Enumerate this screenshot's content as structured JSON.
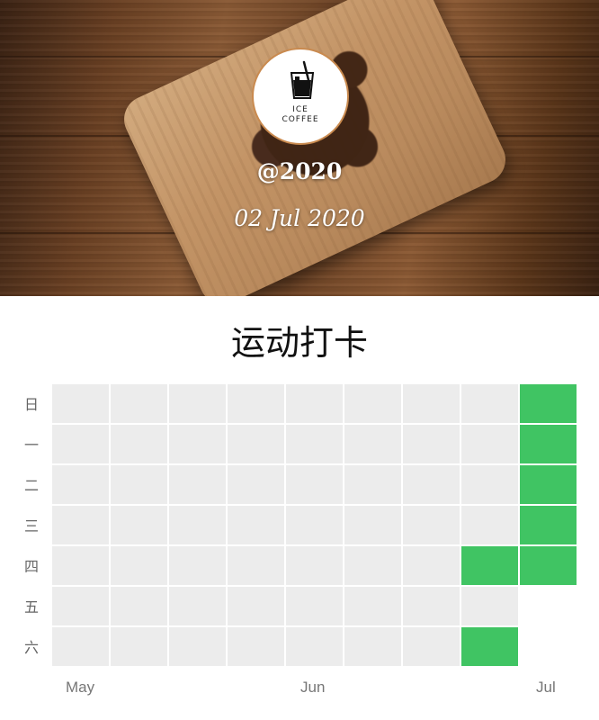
{
  "header": {
    "handle": "@2020",
    "date": "02 Jul 2020",
    "logo_text_line1": "ICE",
    "logo_text_line2": "COFFEE"
  },
  "section_title": "运动打卡",
  "heatmap": {
    "day_labels": [
      "日",
      "一",
      "二",
      "三",
      "四",
      "五",
      "六"
    ],
    "month_labels": [
      "May",
      "Jun",
      "Jul"
    ],
    "week_columns": 9,
    "checked_color": "#40c463",
    "unchecked_color": "#ececec",
    "checked_cells": [
      {
        "week": 7,
        "day": 4
      },
      {
        "week": 7,
        "day": 6
      },
      {
        "week": 8,
        "day": 0
      },
      {
        "week": 8,
        "day": 1
      },
      {
        "week": 8,
        "day": 2
      },
      {
        "week": 8,
        "day": 3
      },
      {
        "week": 8,
        "day": 4
      }
    ],
    "empty_cells": [
      {
        "week": 8,
        "day": 5
      },
      {
        "week": 8,
        "day": 6
      }
    ]
  }
}
